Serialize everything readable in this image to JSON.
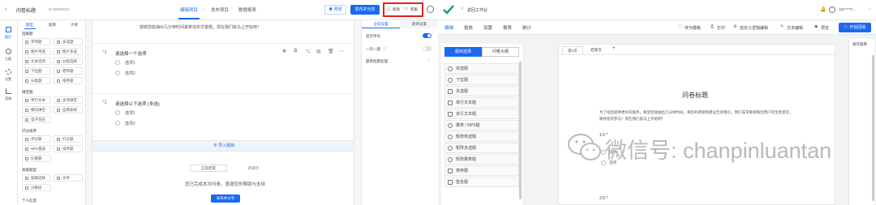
{
  "left_app": {
    "topbar": {
      "title": "问卷标题",
      "subtitle": "ID:88998820",
      "steps": [
        "编辑项目",
        "发布项目",
        "数据报表"
      ],
      "preview": "预览",
      "publish": "发布并分享",
      "help": "帮助",
      "more": "客服"
    },
    "rail": [
      {
        "label": "题目"
      },
      {
        "label": "主题"
      },
      {
        "label": "设置"
      },
      {
        "label": "逻辑"
      }
    ],
    "panel": {
      "tabs": [
        "题型",
        "题库",
        "大纲"
      ],
      "groups": [
        {
          "title": "选择题",
          "items": [
            "单项题",
            "多选题",
            "图片单选",
            "图片多选",
            "文本选项",
            "分组选择",
            "下拉题",
            "矩阵题",
            "分类题",
            "排序题"
          ]
        },
        {
          "title": "填空题",
          "items": [
            "单行文本",
            "多项填空",
            "横向填空",
            "自增表格",
            "电子签名"
          ]
        },
        {
          "title": "打分排序",
          "items": [
            "评分题",
            "打分题",
            "NPS量表",
            "排序题",
            "比重题"
          ]
        },
        {
          "title": "高级题型",
          "items": [
            "级联选择",
            "文件",
            "分数段"
          ]
        },
        {
          "title": "个人信息",
          "items": []
        }
      ]
    },
    "canvas": {
      "intro": "感谢您能抽出几分钟时间来参加本次答题，现在我们就马上开始吧！",
      "q1_num": "*1",
      "q1_title": "请选择一个选项",
      "q1_options": [
        "选项1",
        "选项2"
      ],
      "q2_num": "*2",
      "q2_title": "请选择以下选项 (多选)",
      "q2_options": [
        "选项1",
        "选项2"
      ],
      "import": "导入题目",
      "select_value": "正常结束",
      "select_hint": "的提示",
      "end_text": "您已完成本次问卷，感谢您的帮助与支持",
      "end_button": "发布并分享"
    },
    "settings": {
      "tabs": [
        "全局设置",
        "题目设置"
      ],
      "rows": [
        {
          "label": "显示序号",
          "on": true
        },
        {
          "label": "一页一题",
          "on": false
        },
        {
          "label": "题目批量处理",
          "on": null
        }
      ]
    }
  },
  "right_app": {
    "back": "返回工作台",
    "user": "181****0...",
    "menu": [
      "编辑",
      "投放",
      "设置",
      "报表",
      "统计"
    ],
    "tools": [
      "存为模板",
      "打印",
      "自定义逻辑编辑",
      "文本编辑",
      "预览",
      "开始回收"
    ],
    "left_tabs": [
      "题目选择",
      "问卷大纲"
    ],
    "qtypes": [
      "单选题",
      "下拉题",
      "多选题",
      "单行文本题",
      "多行文本题",
      "量表 / NPS题",
      "矩阵单选题",
      "矩阵多选题",
      "矩阵量表题",
      "排序题",
      "签名题"
    ],
    "page_tabs": [
      "第1页",
      "结束页"
    ],
    "add_tab": "+",
    "outline": "展开题库",
    "survey_title": "问卷标题",
    "survey_desc": "为了给您提供更好的服务，希望您能抽出几分钟时间，将您的感受和建议告诉我们，我们非常重视每位用户的宝贵意见，期待您的参与！现在我们就马上开始吧！",
    "q1": "1.5 *",
    "q1_opts": [
      "选项",
      "选项"
    ],
    "q2": "2.5 *"
  },
  "watermark": "微信号: chanpinluantan"
}
